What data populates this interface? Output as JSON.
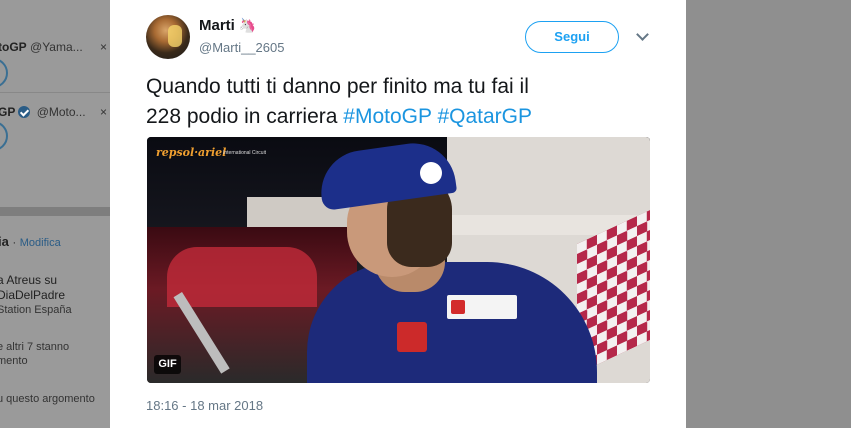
{
  "left": {
    "item1_name": "toGP",
    "item1_handle": "@Yama...",
    "item1_close": "×",
    "item2_name": "GP",
    "item2_handle": "@Moto...",
    "item2_close": "×",
    "trends_title": "ia",
    "trends_change": "Modifica",
    "trend_line1": "a Atreus su",
    "trend_line2": "DiaDelPadre",
    "trend_line3": "Station España",
    "trend_line4": "e altri 7 stanno",
    "trend_line5": "mento",
    "trend_line6": "u questo argomento"
  },
  "tweet": {
    "display_name": "Marti",
    "emoji": "🦄",
    "handle": "@Marti__2605",
    "follow_label": "Segui",
    "text_plain1": "Quando tutti ti danno per finito ma tu fai il",
    "text_plain2": "228 podio in carriera ",
    "hashtag1": "#MotoGP",
    "hashtag2": "#QatarGP",
    "media_brand": "repsol·ariel",
    "media_caption": "International Circuit",
    "gif_label": "GIF",
    "timestamp": "18:16 - 18 mar 2018"
  },
  "colors": {
    "accent": "#1da1f2",
    "hashtag": "#1b95e0",
    "overlay": "#8f8f8f"
  }
}
